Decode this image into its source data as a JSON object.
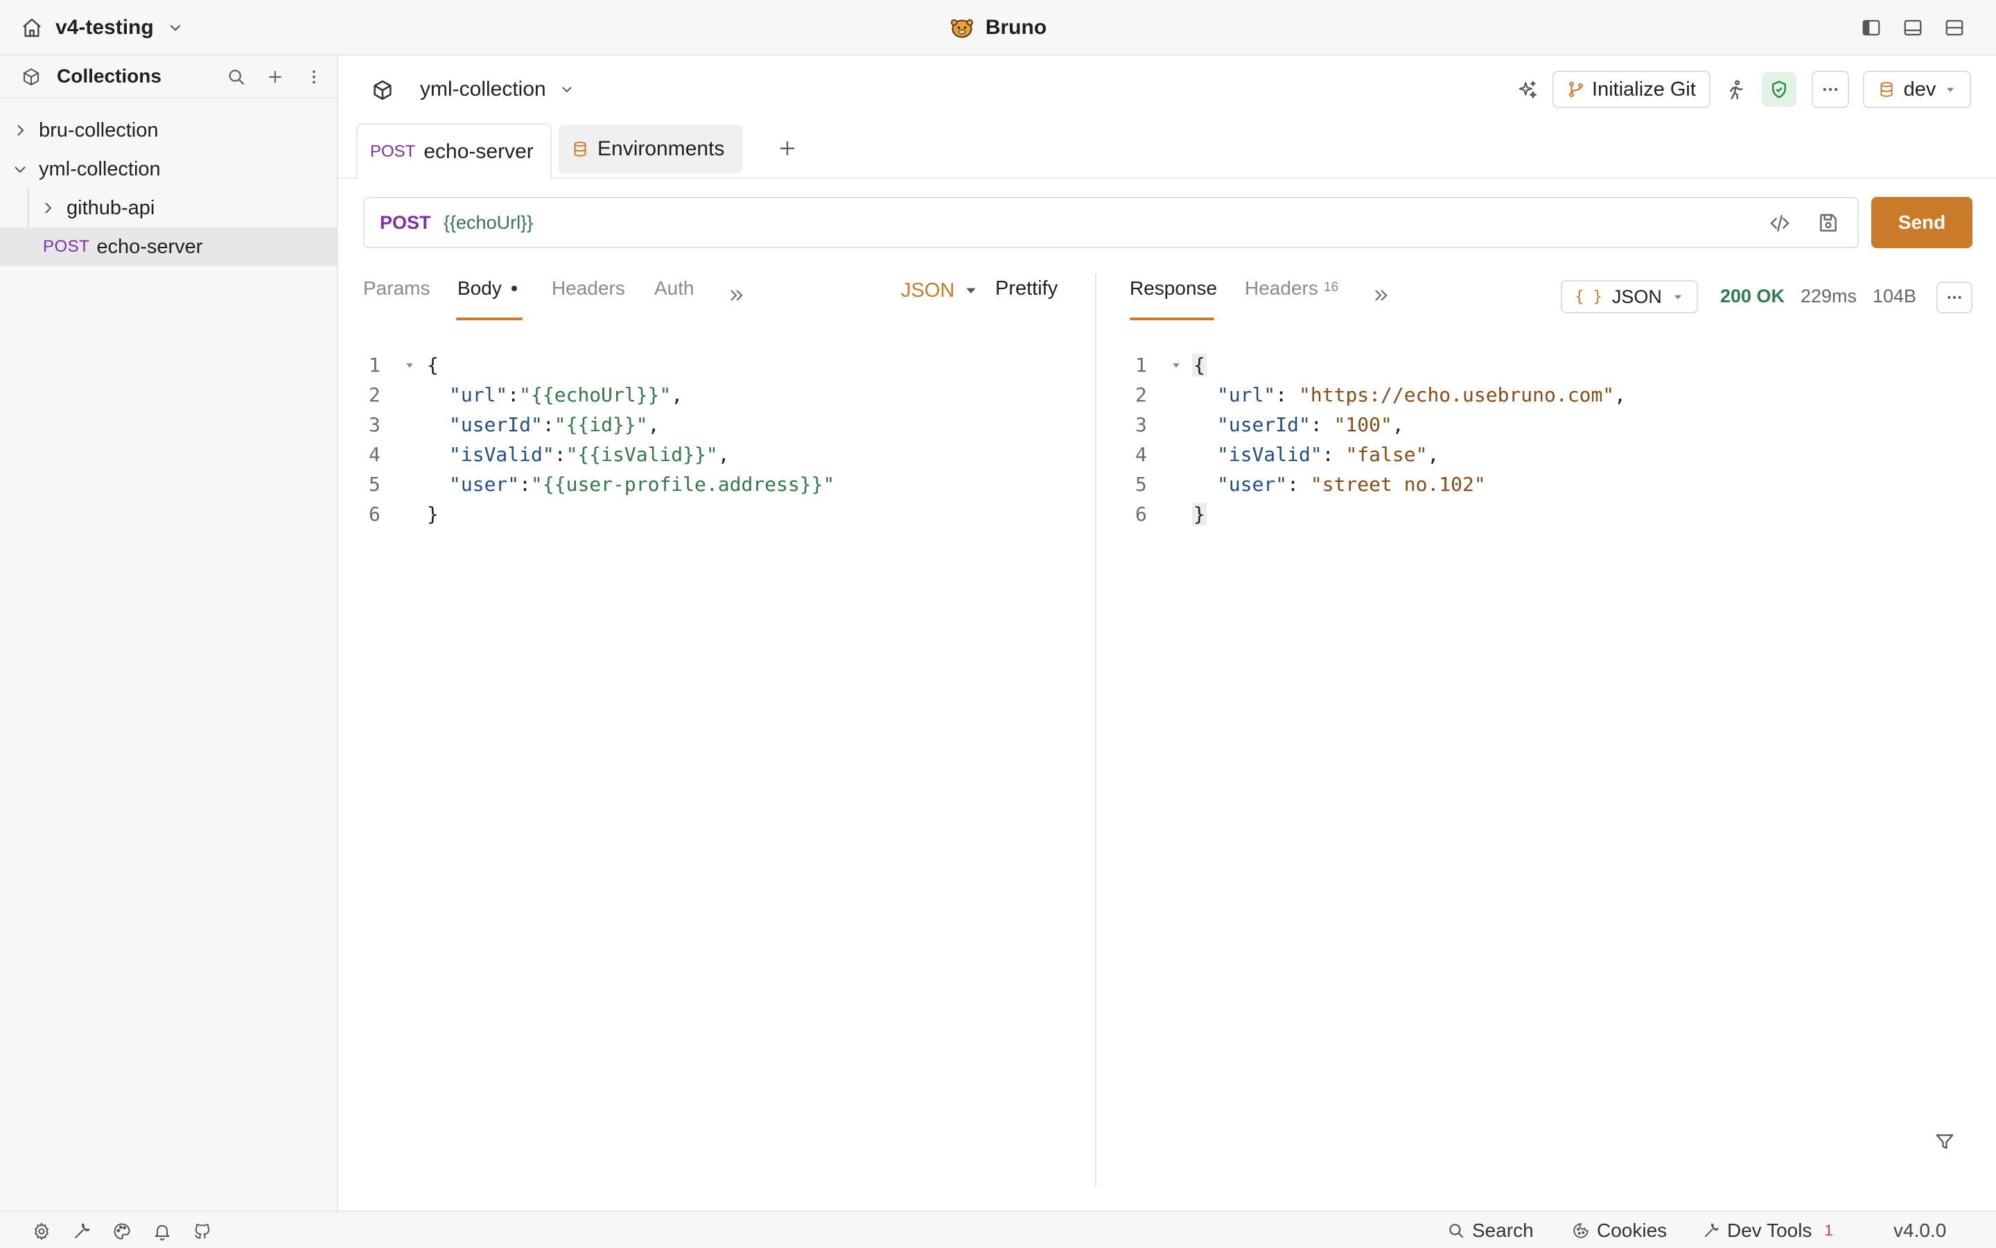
{
  "topbar": {
    "workspace": "v4-testing",
    "app_name": "Bruno"
  },
  "sidebar": {
    "title": "Collections",
    "items": [
      {
        "label": "bru-collection",
        "method": ""
      },
      {
        "label": "yml-collection",
        "method": ""
      },
      {
        "label": "github-api",
        "method": ""
      },
      {
        "label": "echo-server",
        "method": "POST"
      }
    ]
  },
  "header": {
    "collection_name": "yml-collection",
    "init_git_label": "Initialize Git",
    "environment": "dev"
  },
  "tabs": [
    {
      "method": "POST",
      "label": "echo-server"
    },
    {
      "method": "",
      "label": "Environments"
    }
  ],
  "request": {
    "method": "POST",
    "url": "{{echoUrl}}",
    "send_label": "Send",
    "tabs": {
      "params": "Params",
      "body": "Body",
      "headers": "Headers",
      "auth": "Auth"
    },
    "body_mode": "JSON",
    "prettify_label": "Prettify",
    "body_lines": [
      {
        "key": "",
        "value": "",
        "text": "{"
      },
      {
        "key": "\"url\"",
        "value": "\"{{echoUrl}}\""
      },
      {
        "key": "\"userId\"",
        "value": "\"{{id}}\""
      },
      {
        "key": "\"isValid\"",
        "value": "\"{{isValid}}\""
      },
      {
        "key": "\"user\"",
        "value": "\"{{user-profile.address}}\""
      },
      {
        "key": "",
        "value": "",
        "text": "}"
      }
    ]
  },
  "response": {
    "tabs": {
      "response": "Response",
      "headers": "Headers",
      "headers_count": "16"
    },
    "format": "JSON",
    "status": "200 OK",
    "time": "229ms",
    "size": "104B",
    "body_lines": [
      {
        "text": "{"
      },
      {
        "key": "\"url\"",
        "value": "\"https://echo.usebruno.com\""
      },
      {
        "key": "\"userId\"",
        "value": "\"100\""
      },
      {
        "key": "\"isValid\"",
        "value": "\"false\""
      },
      {
        "key": "\"user\"",
        "value": "\"street no.102\""
      },
      {
        "text": "}"
      }
    ]
  },
  "statusbar": {
    "search": "Search",
    "cookies": "Cookies",
    "devtools": "Dev Tools",
    "devtools_count": "1",
    "version": "v4.0.0"
  },
  "colors": {
    "accent": "#c97b2a",
    "method_post": "#7b2fa8",
    "status_ok": "#2e7d4a",
    "json_key": "#1f4e8c",
    "request_string": "#2f7a45",
    "response_string": "#8a4b14"
  }
}
